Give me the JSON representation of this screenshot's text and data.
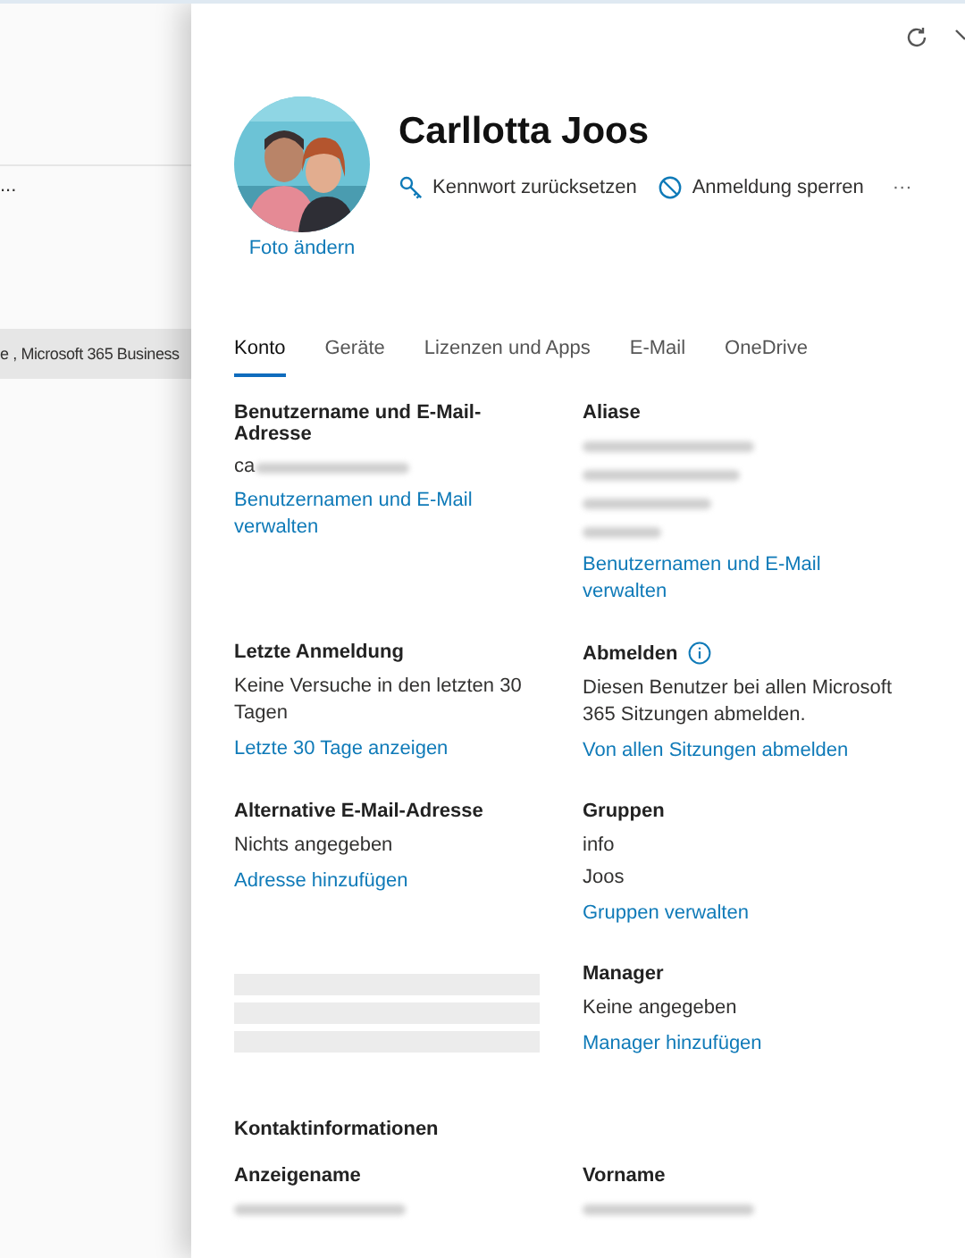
{
  "background": {
    "more": "...",
    "row_text": "e , Microsoft 365 Business"
  },
  "header": {
    "name": "Carllotta Joos",
    "photo_link": "Foto ändern",
    "actions": [
      {
        "kind": "key",
        "label": "Kennwort zurücksetzen"
      },
      {
        "kind": "block",
        "label": "Anmeldung sperren"
      }
    ],
    "more": "···"
  },
  "tabs": [
    {
      "label": "Konto",
      "selected": true
    },
    {
      "label": "Geräte",
      "selected": false
    },
    {
      "label": "Lizenzen und Apps",
      "selected": false
    },
    {
      "label": "E-Mail",
      "selected": false
    },
    {
      "label": "OneDrive",
      "selected": false
    }
  ],
  "rows": [
    [
      {
        "title": "Benutzername und E-Mail-Adresse",
        "lines": [
          {
            "kind": "partial",
            "text": "ca"
          },
          {
            "kind": "link",
            "text": "Benutzernamen und E-Mail verwalten"
          }
        ]
      },
      {
        "title": "Aliase",
        "lines": [
          {
            "kind": "blurred"
          },
          {
            "kind": "blurred"
          },
          {
            "kind": "blurred"
          },
          {
            "kind": "blurred"
          },
          {
            "kind": "link",
            "text": "Benutzernamen und E-Mail verwalten"
          }
        ]
      }
    ],
    [
      {
        "title": "Letzte Anmeldung",
        "lines": [
          {
            "kind": "text",
            "text": "Keine Versuche in den letzten 30 Tagen"
          },
          {
            "kind": "link",
            "text": "Letzte 30 Tage anzeigen"
          }
        ]
      },
      {
        "title": "Abmelden",
        "info": true,
        "lines": [
          {
            "kind": "text",
            "text": "Diesen Benutzer bei allen Microsoft 365 Sitzungen abmelden."
          },
          {
            "kind": "link",
            "text": "Von allen Sitzungen abmelden"
          }
        ]
      }
    ],
    [
      {
        "title": "Alternative E-Mail-Adresse",
        "lines": [
          {
            "kind": "text",
            "text": "Nichts angegeben"
          },
          {
            "kind": "link",
            "text": "Adresse hinzufügen"
          }
        ]
      },
      {
        "title": "Gruppen",
        "lines": [
          {
            "kind": "text",
            "text": "info"
          },
          {
            "kind": "text",
            "text": "Joos"
          },
          {
            "kind": "link",
            "text": "Gruppen verwalten"
          }
        ]
      }
    ],
    [
      {
        "lines": [
          {
            "kind": "skeleton"
          },
          {
            "kind": "skeleton"
          },
          {
            "kind": "skeleton"
          }
        ]
      },
      {
        "title": "Manager",
        "lines": [
          {
            "kind": "text",
            "text": "Keine angegeben"
          },
          {
            "kind": "link",
            "text": "Manager hinzufügen"
          }
        ]
      }
    ]
  ],
  "contact": {
    "heading": "Kontaktinformationen",
    "fields": [
      {
        "title": "Anzeigename",
        "lines": [
          {
            "kind": "blurred"
          }
        ]
      },
      {
        "title": "Vorname",
        "lines": [
          {
            "kind": "blurred"
          }
        ]
      }
    ]
  }
}
